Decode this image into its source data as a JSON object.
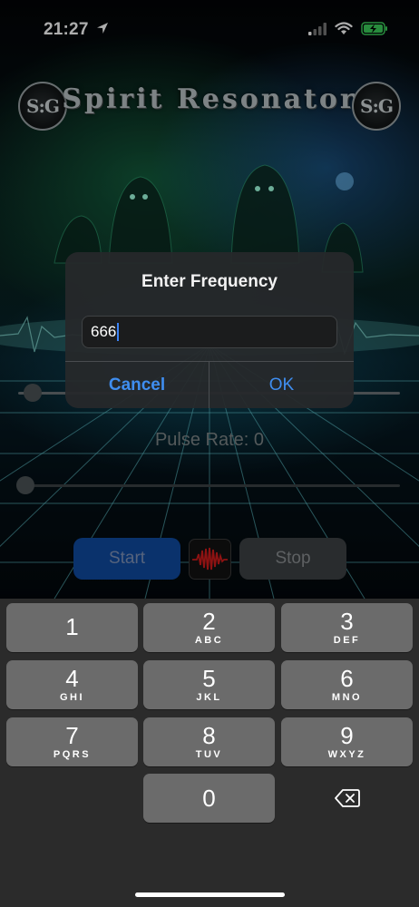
{
  "status_bar": {
    "time": "21:27",
    "icons": [
      "location-arrow-icon",
      "cellular-signal-icon",
      "wifi-icon",
      "battery-charging-icon"
    ]
  },
  "header": {
    "logo_text": "S:G",
    "title": "Spirit Resonator"
  },
  "controls": {
    "frequency_slider_level": 0.04,
    "pulse_label": "Pulse Rate: 0",
    "pulse_slider_level": 0.0,
    "start_label": "Start",
    "stop_label": "Stop",
    "waveform_icon": "waveform-icon",
    "start_color": "#0f4aa0",
    "stop_color": "#3d4144"
  },
  "dialog": {
    "title": "Enter Frequency",
    "input_value": "666",
    "cancel_label": "Cancel",
    "ok_label": "OK",
    "button_color": "#3f8ef0"
  },
  "keyboard": {
    "keys": [
      {
        "digit": "1",
        "letters": ""
      },
      {
        "digit": "2",
        "letters": "ABC"
      },
      {
        "digit": "3",
        "letters": "DEF"
      },
      {
        "digit": "4",
        "letters": "GHI"
      },
      {
        "digit": "5",
        "letters": "JKL"
      },
      {
        "digit": "6",
        "letters": "MNO"
      },
      {
        "digit": "7",
        "letters": "PQRS"
      },
      {
        "digit": "8",
        "letters": "TUV"
      },
      {
        "digit": "9",
        "letters": "WXYZ"
      },
      {
        "digit": "0",
        "letters": ""
      }
    ],
    "delete_icon": "backspace-icon"
  }
}
